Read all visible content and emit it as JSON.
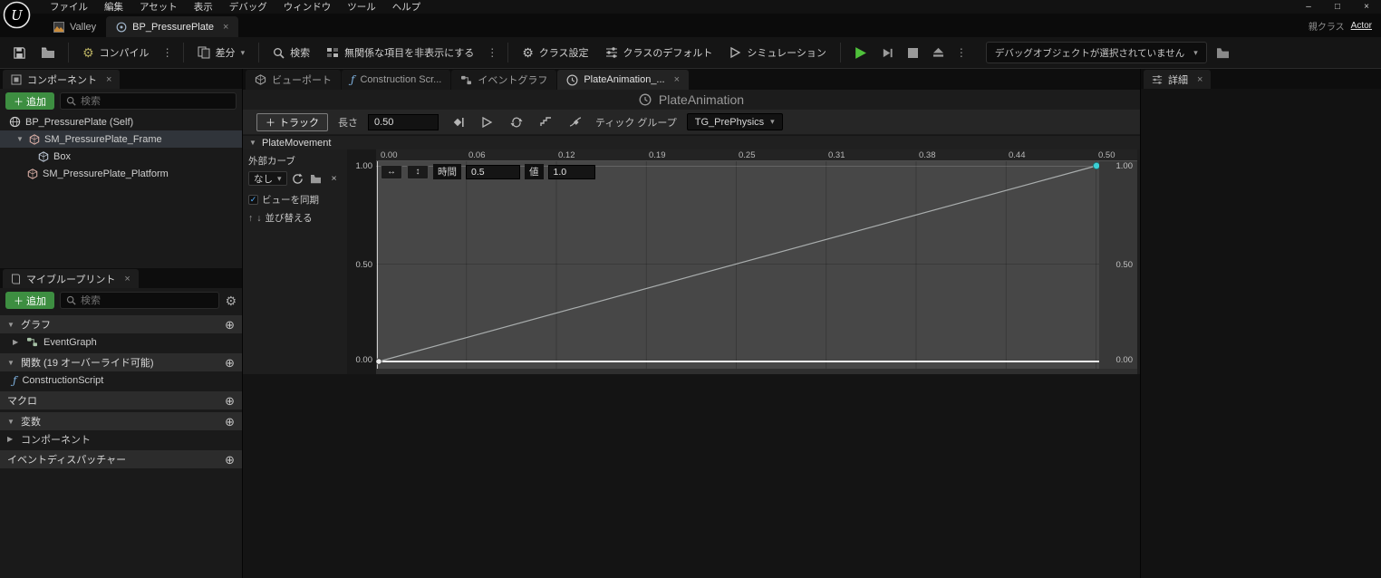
{
  "menu": {
    "items": [
      "ファイル",
      "編集",
      "アセット",
      "表示",
      "デバッグ",
      "ウィンドウ",
      "ツール",
      "ヘルプ"
    ]
  },
  "window_tabs": {
    "level_tab": "Valley",
    "doc_tab": "BP_PressurePlate",
    "parent_class_label": "親クラス",
    "parent_class_value": "Actor"
  },
  "toolbar": {
    "compile": "コンパイル",
    "diff": "差分",
    "search": "検索",
    "hide_unrelated": "無関係な項目を非表示にする",
    "class_settings": "クラス設定",
    "class_defaults": "クラスのデフォルト",
    "simulation": "シミュレーション",
    "debug_object": "デバッグオブジェクトが選択されていません"
  },
  "components": {
    "tab": "コンポーネント",
    "add": "追加",
    "search_placeholder": "検索",
    "rows": [
      {
        "label": "BP_PressurePlate (Self)"
      },
      {
        "label": "SM_PressurePlate_Frame"
      },
      {
        "label": "Box"
      },
      {
        "label": "SM_PressurePlate_Platform"
      }
    ]
  },
  "my_blueprint": {
    "tab": "マイブループリント",
    "add": "追加",
    "search_placeholder": "検索",
    "graphs_header": "グラフ",
    "eventgraph": "EventGraph",
    "functions_header": "関数 (19 オーバーライド可能)",
    "construction_script": "ConstructionScript",
    "macros_header": "マクロ",
    "variables_header": "変数",
    "components_header": "コンポーネント",
    "dispatchers_header": "イベントディスパッチャー"
  },
  "doc_tabs": {
    "viewport": "ビューポート",
    "construction": "Construction Scr...",
    "eventgraph": "イベントグラフ",
    "timeline": "PlateAnimation_..."
  },
  "timeline": {
    "title": "PlateAnimation",
    "add_track": "トラック",
    "length_label": "長さ",
    "length_value": "0.50",
    "tick_group_label": "ティック グループ",
    "tick_group_value": "TG_PrePhysics",
    "track_name": "PlateMovement",
    "external_curve_label": "外部カーブ",
    "external_curve_value": "なし",
    "sync_view": "ビューを同期",
    "reorder": "並び替える",
    "time_label": "時間",
    "time_value": "0.5",
    "value_label": "値",
    "value_value": "1.0",
    "ruler": [
      "0.00",
      "0.06",
      "0.12",
      "0.19",
      "0.25",
      "0.31",
      "0.38",
      "0.44",
      "0.50"
    ],
    "value_ticks": [
      "1.00",
      "0.50",
      "0.00"
    ],
    "time_range": [
      0,
      0.5
    ],
    "value_range": [
      0,
      1
    ],
    "keyframes": [
      {
        "time": 0,
        "value": 0
      },
      {
        "time": 0.5,
        "value": 1
      }
    ]
  },
  "details": {
    "tab": "詳細"
  },
  "icons": {
    "dots": "⋮",
    "caret": "▾",
    "expand": "▼",
    "collapse": "▶",
    "close": "×",
    "plus": "＋",
    "plus_circle": "⊕",
    "up": "↑",
    "down": "↓",
    "swap_h": "↔",
    "swap_v": "↕",
    "gear": "⚙",
    "check": "✓",
    "fx": "ƒ",
    "minimize": "–",
    "maximize": "□"
  }
}
